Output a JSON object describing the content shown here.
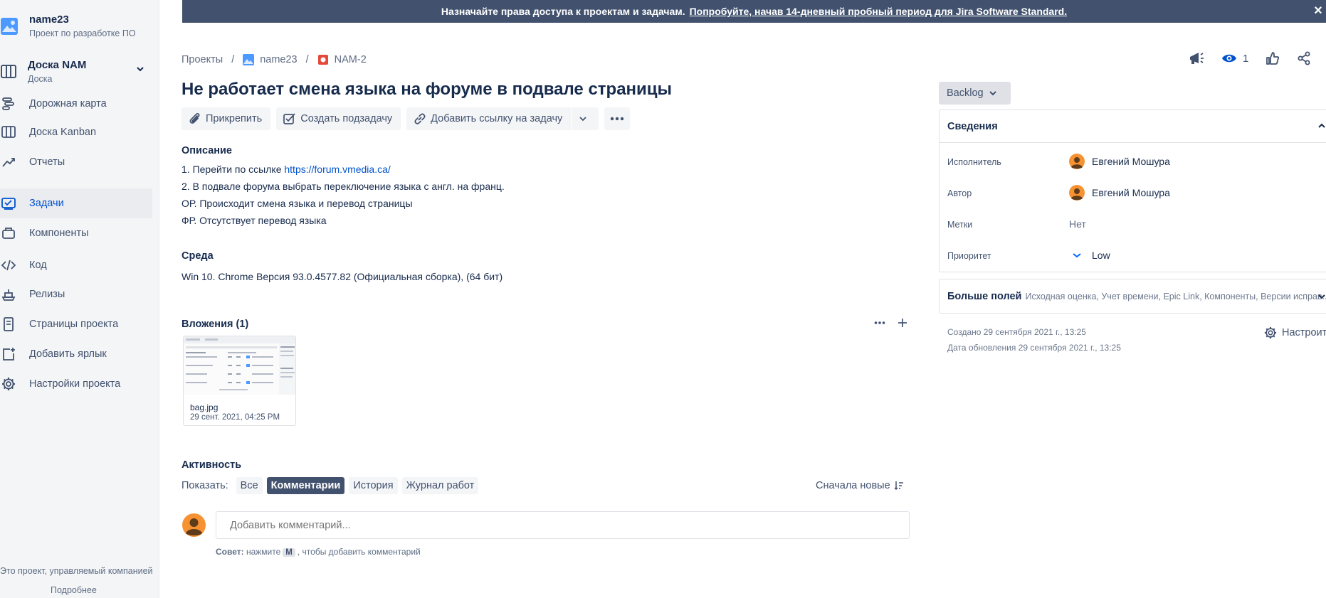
{
  "sidebar": {
    "project_name": "name23",
    "project_type": "Проект по разработке ПО",
    "board_title": "Доска NAM",
    "board_sub": "Доска",
    "items": [
      {
        "label": "Дорожная карта",
        "icon": "roadmap-icon"
      },
      {
        "label": "Доска Kanban",
        "icon": "board-icon"
      },
      {
        "label": "Отчеты",
        "icon": "reports-icon"
      },
      {
        "label": "Задачи",
        "icon": "issues-icon"
      },
      {
        "label": "Компоненты",
        "icon": "components-icon"
      },
      {
        "label": "Код",
        "icon": "code-icon"
      },
      {
        "label": "Релизы",
        "icon": "releases-icon"
      },
      {
        "label": "Страницы проекта",
        "icon": "page-icon"
      },
      {
        "label": "Добавить ярлык",
        "icon": "add-shortcut-icon"
      },
      {
        "label": "Настройки проекта",
        "icon": "gear-icon"
      }
    ],
    "footer_text": "Это проект, управляемый компанией",
    "footer_link": "Подробнее"
  },
  "banner": {
    "text": "Назначайте права доступа к проектам и задачам.",
    "link": "Попробуйте, начав 14-дневный пробный период для Jira Software Standard.",
    "close": "×"
  },
  "breadcrumbs": {
    "projects": "Проекты",
    "project": "name23",
    "issue": "NAM-2"
  },
  "watch_count": "1",
  "issue": {
    "title": "Не работает смена языка на форуме в подвале страницы",
    "toolbar": {
      "attach": "Прикрепить",
      "subtask": "Создать подзадачу",
      "link": "Добавить ссылку на задачу"
    },
    "description_label": "Описание",
    "description": {
      "line1_prefix": "1. Перейти по ссылке ",
      "line1_link": "https://forum.vmedia.ca/",
      "line2": "2. В подвале форума выбрать переключение языка с англ. на франц.",
      "line3": "ОР. Происходит смена языка и перевод страницы",
      "line4": "ФР. Отсутствует перевод языка"
    },
    "environment_label": "Среда",
    "environment": "Win 10. Chrome Версия 93.0.4577.82 (Официальная сборка), (64 бит)",
    "attachments_label": "Вложения (1)",
    "attachment": {
      "name": "bag.jpg",
      "date": "29 сент. 2021, 04:25 PM"
    },
    "activity_label": "Активность",
    "show_label": "Показать:",
    "filters": [
      "Все",
      "Комментарии",
      "История",
      "Журнал работ"
    ],
    "sort": "Сначала новые",
    "comment_placeholder": "Добавить комментарий...",
    "tip_bold": "Совет:",
    "tip_text1": "нажмите",
    "tip_key": "M",
    "tip_text2": ", чтобы добавить комментарий"
  },
  "panel": {
    "status": "Backlog",
    "details_label": "Сведения",
    "fields": {
      "assignee_label": "Исполнитель",
      "assignee": "Евгений Мошура",
      "reporter_label": "Автор",
      "reporter": "Евгений Мошура",
      "labels_label": "Метки",
      "labels": "Нет",
      "priority_label": "Приоритет",
      "priority": "Low"
    },
    "more_label": "Больше полей",
    "more_fields": "Исходная оценка, Учет времени, Epic Link, Компоненты, Версии исправ...",
    "created": "Создано 29 сентября 2021 г., 13:25",
    "updated": "Дата обновления 29 сентября 2021 г., 13:25",
    "configure": "Настроить"
  },
  "colors": {
    "banner": "#42526e",
    "link": "#0052cc",
    "priority_low": "#0065ff",
    "avatar": "#f79232",
    "bug": "#e5493a"
  }
}
